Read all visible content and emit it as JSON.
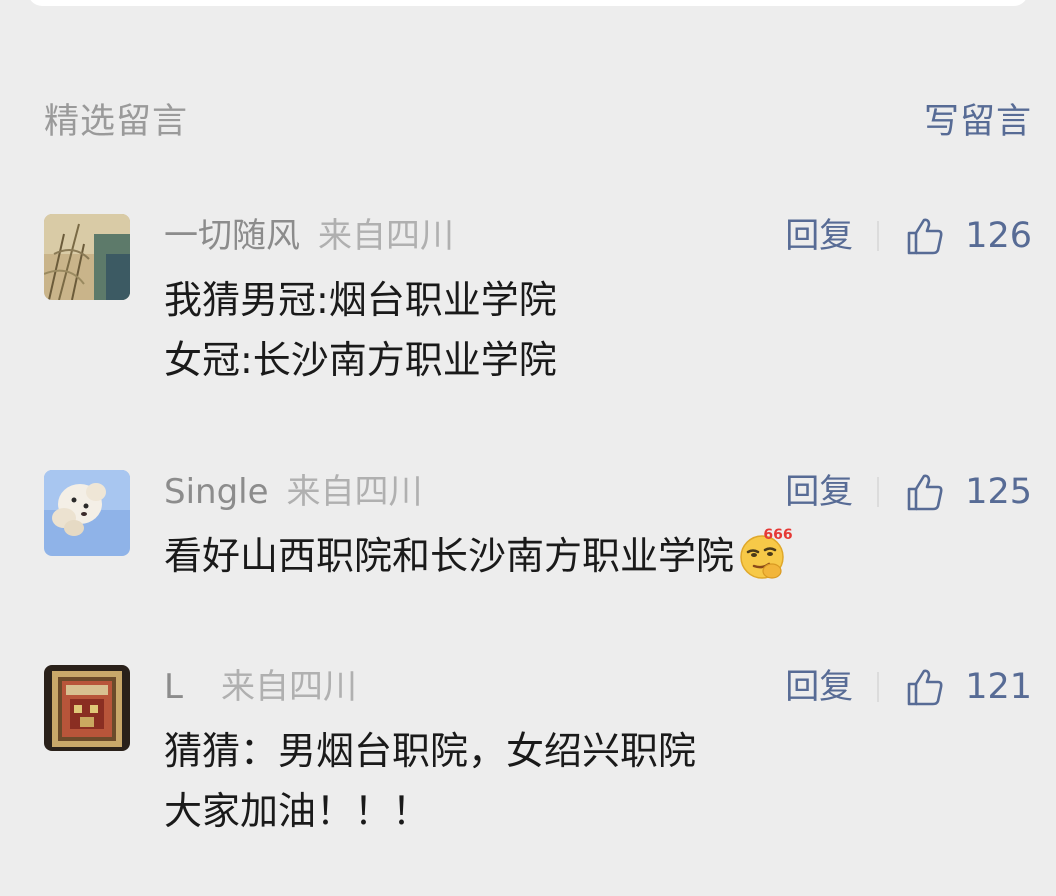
{
  "section": {
    "title": "精选留言",
    "write_label": "写留言"
  },
  "comments": [
    {
      "nickname": "一切随风",
      "location": "来自四川",
      "reply_label": "回复",
      "likes": "126",
      "text": "我猜男冠:烟台职业学院\n女冠:长沙南方职业学院"
    },
    {
      "nickname": "Single",
      "location": "来自四川",
      "reply_label": "回复",
      "likes": "125",
      "text": "看好山西职院和长沙南方职业学院",
      "emoji": "smirk-666-emoji",
      "emoji_label": "666"
    },
    {
      "nickname": "L",
      "location": "来自四川",
      "reply_label": "回复",
      "likes": "121",
      "text": "猜猜：男烟台职院，女绍兴职院\n大家加油！！！"
    }
  ],
  "colors": {
    "background": "#ededed",
    "link": "#576b95",
    "muted": "#9a9a9a",
    "text": "#1a1a1a"
  },
  "icons": {
    "like": "thumbs-up-icon"
  }
}
